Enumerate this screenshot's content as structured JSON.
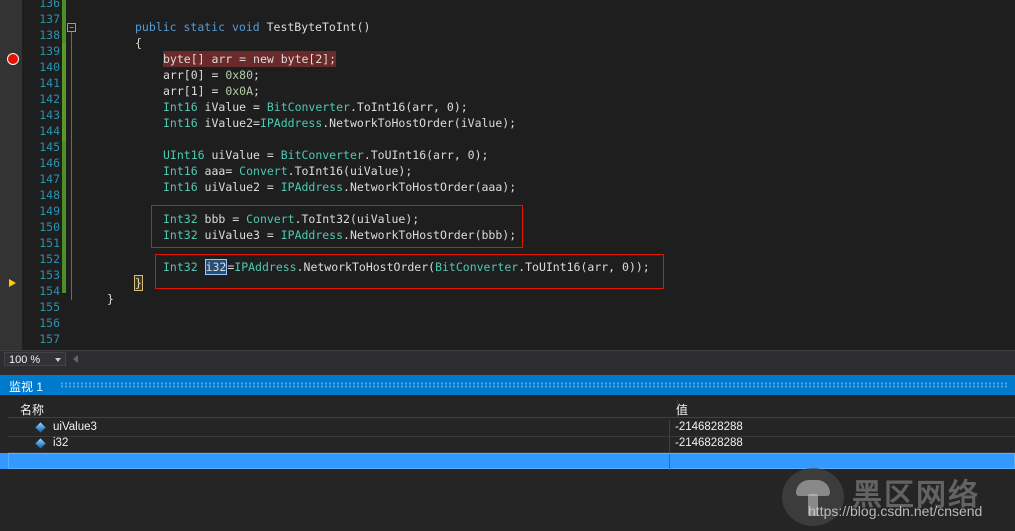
{
  "editor": {
    "line_numbers": [
      "136",
      "137",
      "138",
      "139",
      "140",
      "141",
      "142",
      "143",
      "144",
      "145",
      "146",
      "147",
      "148",
      "149",
      "150",
      "151",
      "152",
      "153",
      "154",
      "155",
      "156",
      "157"
    ],
    "lines": {
      "l137": {
        "kw1": "public",
        "kw2": "static",
        "kw3": "void",
        "name": " TestByteToInt()"
      },
      "l138": "{",
      "l139": {
        "a": "byte[] arr = ",
        "kw": "new",
        "b": " byte[2];"
      },
      "l140": {
        "a": "arr[0] = ",
        "lit": "0x80",
        "b": ";"
      },
      "l141": {
        "a": "arr[1] = ",
        "lit": "0x0A",
        "b": ";"
      },
      "l142": {
        "ty": "Int16",
        "a": " iValue = ",
        "ty2": "BitConverter",
        "b": ".ToInt16(arr, 0);"
      },
      "l143": {
        "ty": "Int16",
        "a": " iValue2=",
        "ty2": "IPAddress",
        "b": ".NetworkToHostOrder(iValue);"
      },
      "l146": {
        "ty": "UInt16",
        "a": " uiValue = ",
        "ty2": "BitConverter",
        "b": ".ToUInt16(arr, 0);"
      },
      "l147": {
        "ty": "Int16",
        "a": " aaa= ",
        "ty2": "Convert",
        "b": ".ToInt16(uiValue);"
      },
      "l148": {
        "ty": "Int16",
        "a": " uiValue2 = ",
        "ty2": "IPAddress",
        "b": ".NetworkToHostOrder(aaa);"
      },
      "l149": {
        "ty": "Int32",
        "a": " bbb = ",
        "ty2": "Convert",
        "b": ".ToInt32(uiValue);"
      },
      "l150": {
        "ty": "Int32",
        "a": " uiValue3 = ",
        "ty2": "IPAddress",
        "b": ".NetworkToHostOrder(bbb);"
      },
      "l152": {
        "ty": "Int32",
        "sel": "i32",
        "a": "=",
        "ty2": "IPAddress",
        "b": ".NetworkToHostOrder(",
        "ty3": "BitConverter",
        "c": ".ToUInt16(arr, 0));"
      },
      "l153": "}",
      "l154": "}"
    },
    "colors": {
      "keyword": "#569cd6",
      "type": "#4ec9b0",
      "literal": "#b5cea8",
      "breakpoint": "#e51400",
      "highlight_box": "#e51400"
    }
  },
  "zoom": {
    "value": "100 %"
  },
  "watch": {
    "title": "监视 1",
    "col_name": "名称",
    "col_value": "值",
    "rows": [
      {
        "name": "uiValue3",
        "value": "-2146828288"
      },
      {
        "name": "i32",
        "value": "-2146828288"
      }
    ],
    "accent": "#007acc"
  },
  "watermark": {
    "brand": "黑区网络",
    "url": "https://blog.csdn.net/cnsend"
  }
}
